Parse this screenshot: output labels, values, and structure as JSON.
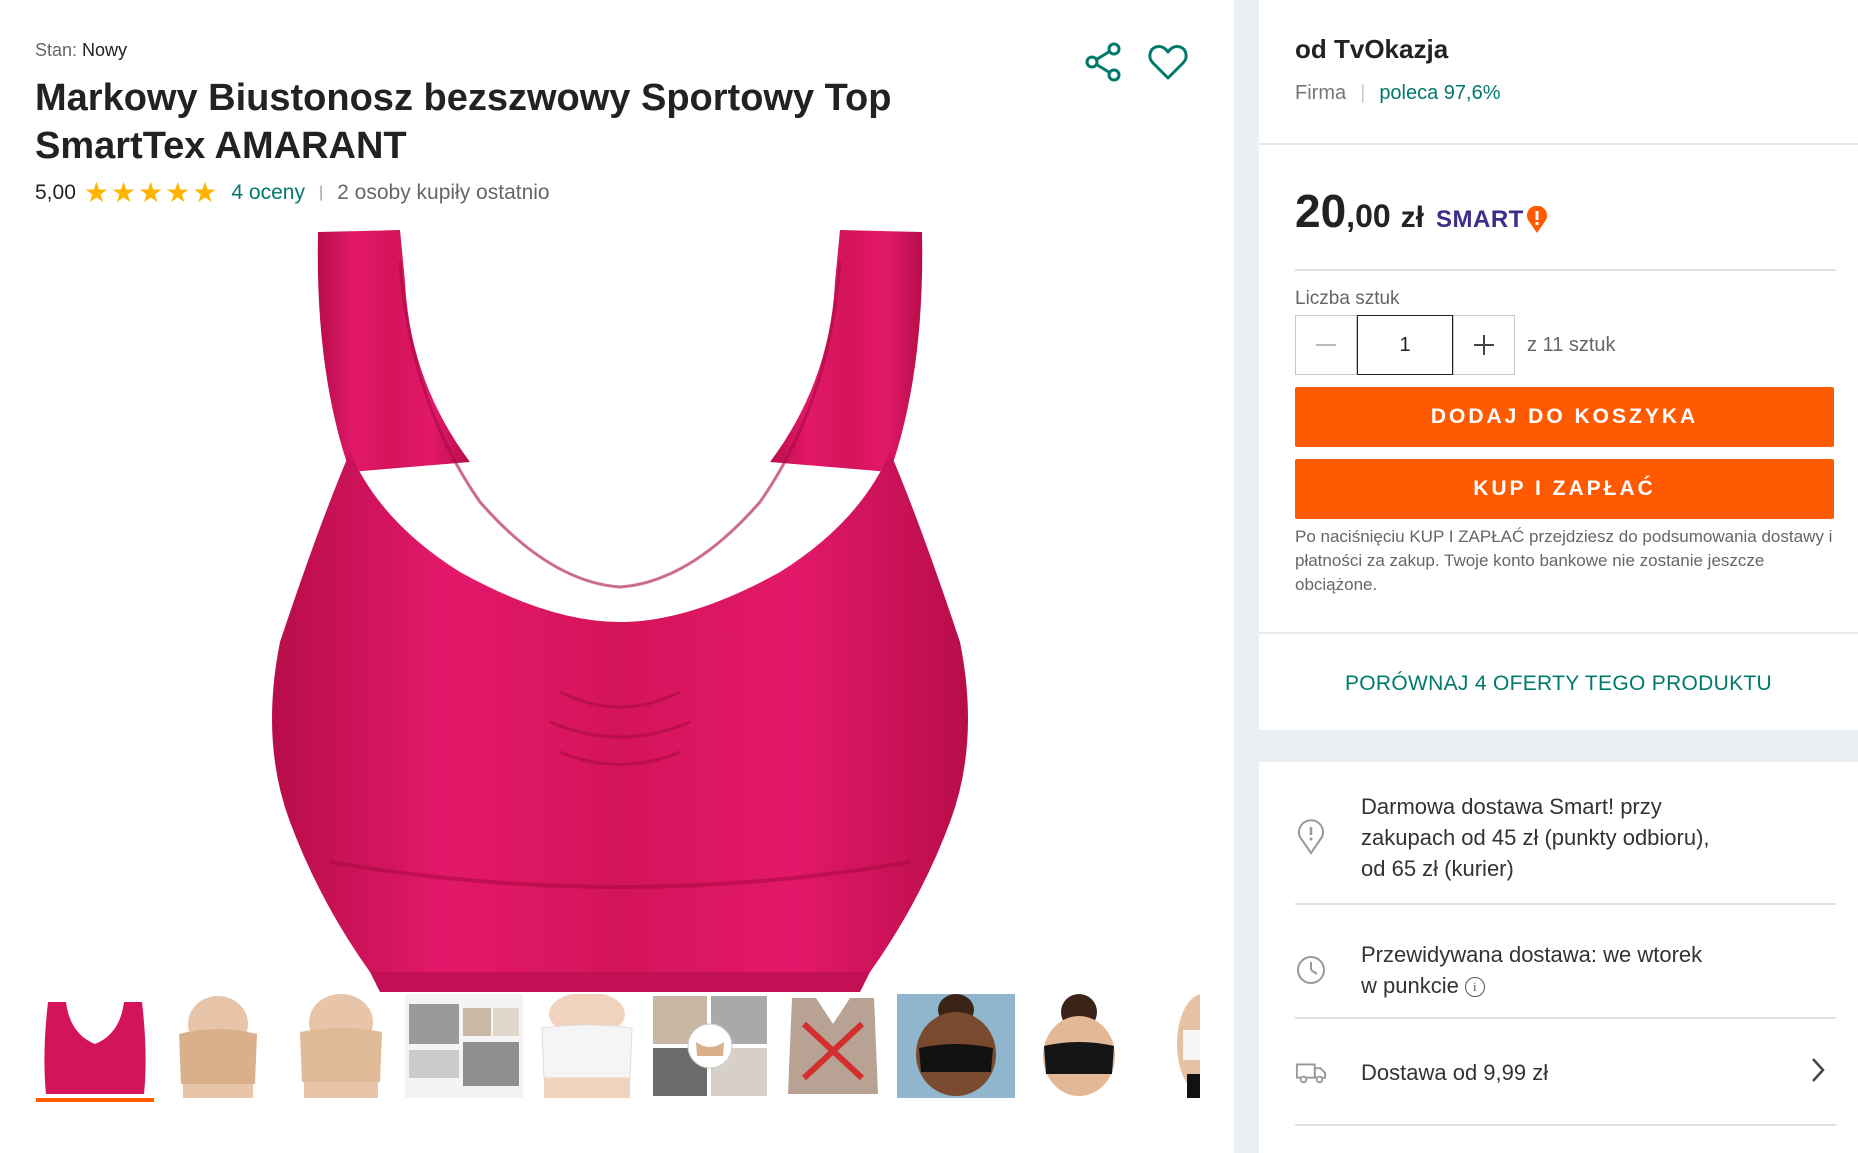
{
  "product": {
    "condition_label": "Stan:",
    "condition_value": "Nowy",
    "title": "Markowy Biustonosz bezszwowy Sportowy Top SmartTex AMARANT",
    "rating_value": "5,00",
    "stars": 5,
    "ratings_count": "4 oceny",
    "bought_recently": "2 osoby kupiły ostatnio",
    "accent_color": "#d4145a",
    "icons": {
      "share": "share-icon",
      "favorite": "heart-icon"
    }
  },
  "gallery": {
    "thumbnails": [
      {
        "name": "thumb-pink-bra",
        "active": true
      },
      {
        "name": "thumb-beige-bra-front"
      },
      {
        "name": "thumb-beige-bra-stretch"
      },
      {
        "name": "thumb-collage"
      },
      {
        "name": "thumb-white-bra"
      },
      {
        "name": "thumb-collage-2"
      },
      {
        "name": "thumb-back-view"
      },
      {
        "name": "thumb-black-bra-model"
      },
      {
        "name": "thumb-black-bra-model-2"
      },
      {
        "name": "thumb-partial"
      }
    ]
  },
  "seller": {
    "name": "od TvOkazja",
    "type": "Firma",
    "recommend": "poleca 97,6%"
  },
  "offer": {
    "price_int": "20",
    "price_dec": ",00",
    "currency": "zł",
    "smart_label": "SMART",
    "qty_label": "Liczba sztuk",
    "qty_value": "1",
    "qty_of": "z 11 sztuk",
    "add_to_cart": "DODAJ DO KOSZYKA",
    "buy_now": "KUP I ZAPŁAĆ",
    "disclaimer": "Po naciśnięciu KUP I ZAPŁAĆ przejdziesz do podsumowania dostawy i płatności za zakup. Twoje konto bankowe nie zostanie jeszcze obciążone.",
    "compare": "PORÓWNAJ 4 OFERTY TEGO PRODUKTU",
    "button_color": "#ff5a00",
    "link_color": "#00796b"
  },
  "delivery": {
    "free_smart": "Darmowa dostawa Smart! przy zakupach od 45 zł (punkty odbioru), od 65 zł (kurier)",
    "expected": "Przewidywana dostawa: we wtorek w punkcie",
    "cost": "Dostawa od 9,99 zł"
  }
}
